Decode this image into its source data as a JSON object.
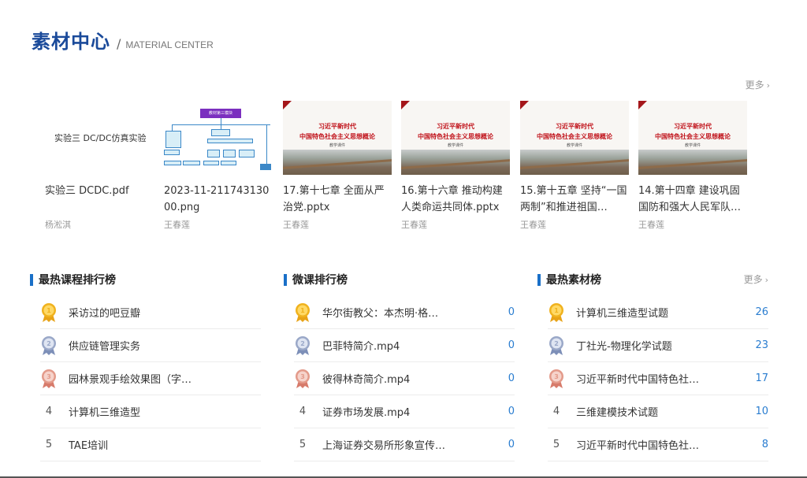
{
  "header": {
    "title_cn": "素材中心",
    "separator": "/",
    "title_en": "MATERIAL CENTER"
  },
  "more_label": "更多",
  "materials": [
    {
      "thumb_type": "text",
      "thumb_text": "实验三  DC/DC仿真实验",
      "name": "实验三 DCDC.pdf",
      "author": "杨淞淇"
    },
    {
      "thumb_type": "diagram",
      "thumb_text": "教材第三模块",
      "name": "2023-11-21174313000.png",
      "author": "王春莲"
    },
    {
      "thumb_type": "ppt",
      "ppt_line1": "习近平新时代",
      "ppt_line2": "中国特色社会主义思想概论",
      "ppt_line3": "教学课件",
      "name": "17.第十七章 全面从严治党.pptx",
      "author": "王春莲"
    },
    {
      "thumb_type": "ppt",
      "ppt_line1": "习近平新时代",
      "ppt_line2": "中国特色社会主义思想概论",
      "ppt_line3": "教学课件",
      "name": "16.第十六章 推动构建人类命运共同体.pptx",
      "author": "王春莲"
    },
    {
      "thumb_type": "ppt",
      "ppt_line1": "习近平新时代",
      "ppt_line2": "中国特色社会主义思想概论",
      "ppt_line3": "教学课件",
      "name": "15.第十五章 坚持“一国两制”和推进祖国…",
      "author": "王春莲"
    },
    {
      "thumb_type": "ppt",
      "ppt_line1": "习近平新时代",
      "ppt_line2": "中国特色社会主义思想概论",
      "ppt_line3": "教学课件",
      "name": "14.第十四章 建设巩固国防和强大人民军队…",
      "author": "王春莲"
    }
  ],
  "rankings": [
    {
      "title": "最热课程排行榜",
      "show_more": false,
      "items": [
        {
          "rank": "1",
          "label": "采访过的吧豆瓣",
          "count": ""
        },
        {
          "rank": "2",
          "label": "供应链管理实务",
          "count": ""
        },
        {
          "rank": "3",
          "label": "园林景观手绘效果图（字…",
          "count": ""
        },
        {
          "rank": "4",
          "label": "计算机三维造型",
          "count": ""
        },
        {
          "rank": "5",
          "label": "TAE培训",
          "count": ""
        }
      ]
    },
    {
      "title": "微课排行榜",
      "show_more": false,
      "items": [
        {
          "rank": "1",
          "label": "华尔街教父：本杰明·格…",
          "count": "0"
        },
        {
          "rank": "2",
          "label": "巴菲特简介.mp4",
          "count": "0"
        },
        {
          "rank": "3",
          "label": "彼得林奇简介.mp4",
          "count": "0"
        },
        {
          "rank": "4",
          "label": "证券市场发展.mp4",
          "count": "0"
        },
        {
          "rank": "5",
          "label": "上海证券交易所形象宣传…",
          "count": "0"
        }
      ]
    },
    {
      "title": "最热素材榜",
      "show_more": true,
      "items": [
        {
          "rank": "1",
          "label": "计算机三维造型试题",
          "count": "26"
        },
        {
          "rank": "2",
          "label": "丁社光-物理化学试题",
          "count": "23"
        },
        {
          "rank": "3",
          "label": "习近平新时代中国特色社…",
          "count": "17"
        },
        {
          "rank": "4",
          "label": "三维建模技术试题",
          "count": "10"
        },
        {
          "rank": "5",
          "label": "习近平新时代中国特色社…",
          "count": "8"
        }
      ]
    }
  ],
  "colors": {
    "brand": "#1a4a9a",
    "accent": "#1a70c8",
    "count": "#2a7dd0",
    "ppt_red": "#c0121a",
    "gold": "#f0b21e",
    "silver": "#9aa8c8",
    "bronze": "#e39a8a"
  }
}
